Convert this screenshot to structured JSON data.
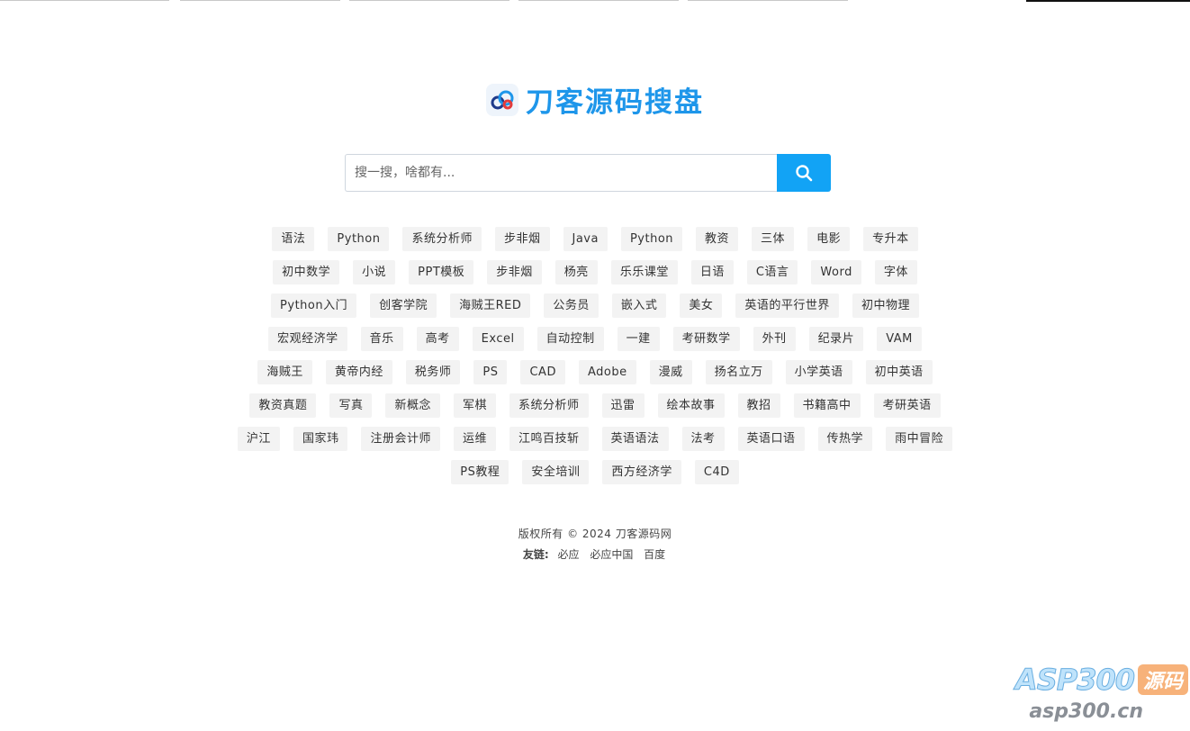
{
  "logo": {
    "icon": "cloud-link-icon",
    "title": "刀客源码搜盘",
    "color": "#1e96ea"
  },
  "search": {
    "placeholder": "搜一搜，啥都有...",
    "value": "",
    "button_icon": "search-icon",
    "button_color": "#12a3f5"
  },
  "tag_rows": [
    [
      "语法",
      "Python",
      "系统分析师",
      "步非烟",
      "Java",
      "Python",
      "教资",
      "三体",
      "电影",
      "专升本"
    ],
    [
      "初中数学",
      "小说",
      "PPT模板",
      "步非烟",
      "杨亮",
      "乐乐课堂",
      "日语",
      "C语言",
      "Word",
      "字体"
    ],
    [
      "Python入门",
      "创客学院",
      "海贼王RED",
      "公务员",
      "嵌入式",
      "美女",
      "英语的平行世界",
      "初中物理"
    ],
    [
      "宏观经济学",
      "音乐",
      "高考",
      "Excel",
      "自动控制",
      "一建",
      "考研数学",
      "外刊",
      "纪录片",
      "VAM"
    ],
    [
      "海贼王",
      "黄帝内经",
      "税务师",
      "PS",
      "CAD",
      "Adobe",
      "漫威",
      "扬名立万",
      "小学英语",
      "初中英语"
    ],
    [
      "教资真题",
      "写真",
      "新概念",
      "军棋",
      "系统分析师",
      "迅雷",
      "绘本故事",
      "教招",
      "书籍高中",
      "考研英语"
    ],
    [
      "沪江",
      "国家玮",
      "注册会计师",
      "运维",
      "江鸣百技斩",
      "英语语法",
      "法考",
      "英语口语",
      "传热学",
      "雨中冒险"
    ],
    [
      "PS教程",
      "安全培训",
      "西方经济学",
      "C4D"
    ]
  ],
  "footer": {
    "copyright": "版权所有 © 2024 刀客源码网",
    "friends_label": "友链:",
    "friends": [
      "必应",
      "必应中国",
      "百度"
    ]
  },
  "watermark": {
    "brand": "ASP300",
    "badge": "源码",
    "url": "asp300.cn"
  }
}
